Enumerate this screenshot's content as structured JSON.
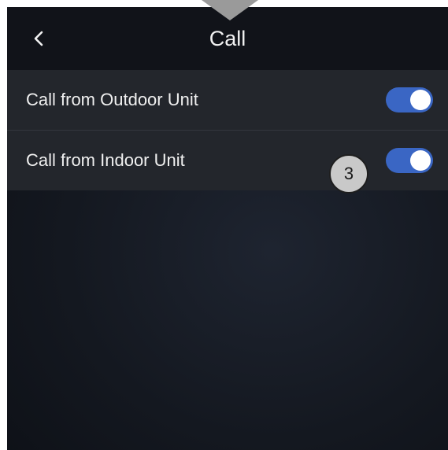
{
  "header": {
    "title": "Call",
    "back_icon": "chevron-left-icon"
  },
  "settings": [
    {
      "label": "Call from Outdoor Unit",
      "enabled": true
    },
    {
      "label": "Call from Indoor Unit",
      "enabled": true
    }
  ],
  "annotation": {
    "callout_number": "3",
    "indicator_icon": "down-arrow-icon"
  },
  "colors": {
    "toggle_on": "#3a66c4",
    "background": "#141820",
    "list_background": "#23262c",
    "annotation_gray": "#9a9a9a"
  }
}
